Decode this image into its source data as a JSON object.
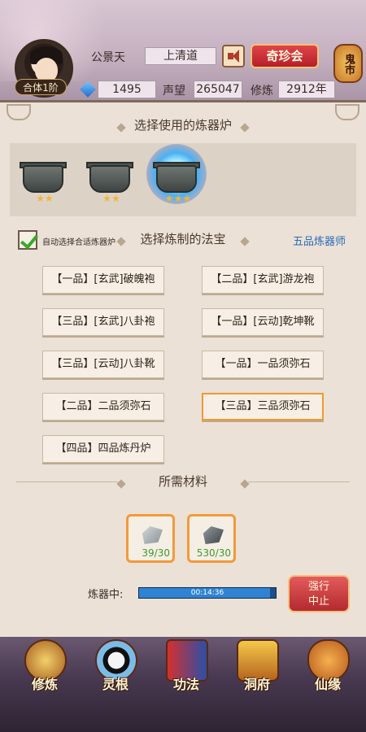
{
  "header": {
    "player_name": "公景天",
    "rank_badge": "合体1阶",
    "realm": "上清道",
    "treasure_button": "奇珍会",
    "ghost_market": "鬼市",
    "gems": "1495",
    "reputation_label": "声望",
    "reputation_value": "265047",
    "cultivation_label": "修炼",
    "cultivation_value": "2912年"
  },
  "furnace_section": {
    "title": "选择使用的炼器炉",
    "furnaces": [
      {
        "stars": "★★"
      },
      {
        "stars": "★★"
      },
      {
        "stars": "★★★"
      }
    ]
  },
  "treasure_section": {
    "auto_select_label": "自动选择合适炼器炉",
    "auto_select_checked": true,
    "title": "选择炼制的法宝",
    "refiner_rank": "五品炼器师",
    "items": [
      {
        "label": "【一品】[玄武]破魄袍"
      },
      {
        "label": "【二品】[玄武]游龙袍"
      },
      {
        "label": "【三品】[玄武]八卦袍"
      },
      {
        "label": "【一品】[云动]乾坤靴"
      },
      {
        "label": "【三品】[云动]八卦靴"
      },
      {
        "label": "【一品】一品须弥石"
      },
      {
        "label": "【二品】二品须弥石"
      },
      {
        "label": "【三品】三品须弥石",
        "selected": true
      },
      {
        "label": "【四品】四品炼丹炉"
      }
    ]
  },
  "materials_section": {
    "title": "所需材料",
    "materials": [
      {
        "icon": "crystal-ore-icon",
        "qty": "39/30"
      },
      {
        "icon": "iron-ore-icon",
        "qty": "530/30"
      }
    ]
  },
  "progress": {
    "label": "炼器中:",
    "time": "00:14:36",
    "percent": 96
  },
  "stop_button": {
    "line1": "强行",
    "line2": "中止"
  },
  "bottom_nav": [
    {
      "label": "修炼",
      "icon": "meditation-icon"
    },
    {
      "label": "灵根",
      "icon": "taiji-icon"
    },
    {
      "label": "功法",
      "icon": "book-icon"
    },
    {
      "label": "洞府",
      "icon": "pavilion-icon"
    },
    {
      "label": "仙缘",
      "icon": "gourd-icon"
    }
  ],
  "colors": {
    "accent_red": "#b51f2a",
    "selection_orange": "#f19a30",
    "link_blue": "#2c6ab8",
    "material_green": "#3f9a2e"
  }
}
